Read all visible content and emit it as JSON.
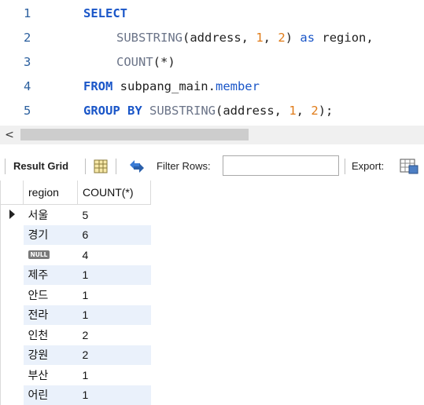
{
  "editor": {
    "lines": [
      {
        "number": "1",
        "tokens": [
          {
            "t": "SELECT",
            "c": "kw"
          }
        ]
      },
      {
        "number": "2",
        "tokens": [
          {
            "t": "SUBSTRING",
            "c": "fn"
          },
          {
            "t": "(address, ",
            "c": "tx"
          },
          {
            "t": "1",
            "c": "num"
          },
          {
            "t": ", ",
            "c": "tx"
          },
          {
            "t": "2",
            "c": "num"
          },
          {
            "t": ") ",
            "c": "tx"
          },
          {
            "t": "as",
            "c": "kw2"
          },
          {
            "t": " region,",
            "c": "tx"
          }
        ]
      },
      {
        "number": "3",
        "tokens": [
          {
            "t": "COUNT",
            "c": "fn"
          },
          {
            "t": "(*)",
            "c": "tx"
          }
        ]
      },
      {
        "number": "4",
        "tokens": [
          {
            "t": "FROM",
            "c": "kw"
          },
          {
            "t": " subpang_main.",
            "c": "tx"
          },
          {
            "t": "member",
            "c": "obj"
          }
        ]
      },
      {
        "number": "5",
        "tokens": [
          {
            "t": "GROUP BY",
            "c": "kw"
          },
          {
            "t": " ",
            "c": "tx"
          },
          {
            "t": "SUBSTRING",
            "c": "fn"
          },
          {
            "t": "(address, ",
            "c": "tx"
          },
          {
            "t": "1",
            "c": "num"
          },
          {
            "t": ", ",
            "c": "tx"
          },
          {
            "t": "2",
            "c": "num"
          },
          {
            "t": ");",
            "c": "tx"
          }
        ]
      }
    ]
  },
  "scrollbar": {
    "left_arrow": "<"
  },
  "toolbar": {
    "result_grid_label": "Result Grid",
    "grid_icon": "grid-view-icon",
    "refresh_icon": "refresh-icon",
    "filter_label": "Filter Rows:",
    "filter_value": "",
    "export_label": "Export:",
    "export_icon": "export-icon"
  },
  "grid": {
    "columns": [
      "region",
      "COUNT(*)"
    ],
    "rows": [
      {
        "region": "서울",
        "count": "5",
        "selected": true
      },
      {
        "region": "경기",
        "count": "6"
      },
      {
        "region": "NULL",
        "count": "4",
        "is_null": true
      },
      {
        "region": "제주",
        "count": "1"
      },
      {
        "region": "안드",
        "count": "1"
      },
      {
        "region": "전라",
        "count": "1"
      },
      {
        "region": "인천",
        "count": "2"
      },
      {
        "region": "강원",
        "count": "2"
      },
      {
        "region": "부산",
        "count": "1"
      },
      {
        "region": "어린",
        "count": "1"
      }
    ]
  }
}
